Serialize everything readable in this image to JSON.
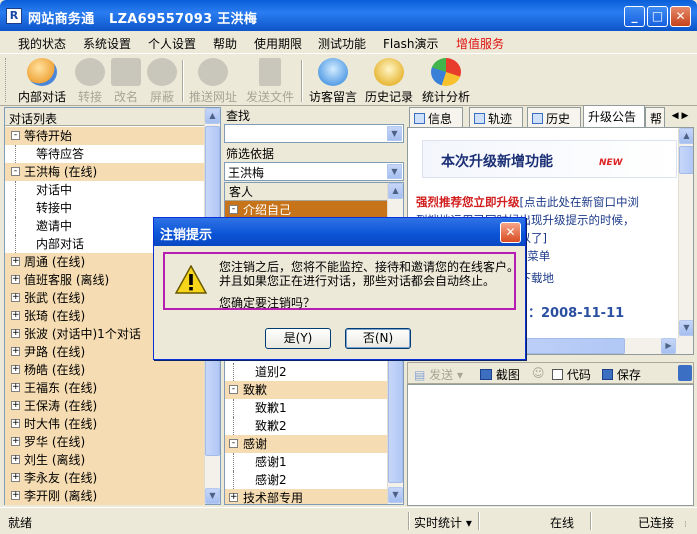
{
  "window": {
    "app_name": "网站商务通",
    "account": "LZA69557093 王洪梅",
    "min": "_",
    "max": "□",
    "close": "✕"
  },
  "menu": [
    "我的状态",
    "系统设置",
    "个人设置",
    "帮助",
    "使用期限",
    "测试功能",
    "Flash演示",
    "增值服务"
  ],
  "menu_highlight_color": "#e01010",
  "toolbar": [
    {
      "label": "内部对话",
      "icon": "people-icon",
      "enabled": true
    },
    {
      "label": "转接",
      "icon": "transfer-icon",
      "enabled": false
    },
    {
      "label": "改名",
      "icon": "rename-icon",
      "enabled": false
    },
    {
      "label": "屏蔽",
      "icon": "block-icon",
      "enabled": false
    },
    {
      "label": "推送网址",
      "icon": "globe-icon",
      "enabled": false
    },
    {
      "label": "发送文件",
      "icon": "file-icon",
      "enabled": false
    },
    {
      "label": "访客留言",
      "icon": "message-icon",
      "enabled": true
    },
    {
      "label": "历史记录",
      "icon": "history-icon",
      "enabled": true
    },
    {
      "label": "统计分析",
      "icon": "pie-chart-icon",
      "enabled": true
    }
  ],
  "left_panel": {
    "header": "对话列表",
    "rows": [
      {
        "text": "等待开始",
        "expander": "-",
        "indent": 0
      },
      {
        "text": "等待应答",
        "expander": "",
        "indent": 1
      },
      {
        "text": "王洪梅  (在线)",
        "expander": "-",
        "indent": 0
      },
      {
        "text": "对话中",
        "expander": "",
        "indent": 1
      },
      {
        "text": "转接中",
        "expander": "",
        "indent": 1
      },
      {
        "text": "邀请中",
        "expander": "",
        "indent": 1
      },
      {
        "text": "内部对话",
        "expander": "",
        "indent": 1
      },
      {
        "text": "周通  (在线)",
        "expander": "+",
        "indent": 0
      },
      {
        "text": "值班客服  (离线)",
        "expander": "+",
        "indent": 0
      },
      {
        "text": "张武  (在线)",
        "expander": "+",
        "indent": 0
      },
      {
        "text": "张琦  (在线)",
        "expander": "+",
        "indent": 0
      },
      {
        "text": "张波  (对话中)1个对话",
        "expander": "+",
        "indent": 0
      },
      {
        "text": "尹路  (在线)",
        "expander": "+",
        "indent": 0
      },
      {
        "text": "杨皓  (在线)",
        "expander": "+",
        "indent": 0
      },
      {
        "text": "王福东  (在线)",
        "expander": "+",
        "indent": 0
      },
      {
        "text": "王保涛  (在线)",
        "expander": "+",
        "indent": 0
      },
      {
        "text": "时大伟  (在线)",
        "expander": "+",
        "indent": 0
      },
      {
        "text": "罗华  (在线)",
        "expander": "+",
        "indent": 0
      },
      {
        "text": "刘生  (离线)",
        "expander": "+",
        "indent": 0
      },
      {
        "text": "李永友  (在线)",
        "expander": "+",
        "indent": 0
      },
      {
        "text": "李开刚  (离线)",
        "expander": "+",
        "indent": 0
      }
    ]
  },
  "mid_panel": {
    "search_label": "查找",
    "search_value": "",
    "filter_label": "筛选依据",
    "filter_value": "王洪梅",
    "list_header": "客人",
    "top_rows": [
      {
        "text": "介绍自己",
        "type": "group-selected",
        "expander": "-"
      }
    ],
    "bottom_rows": [
      {
        "text": "道别2",
        "type": "leaf"
      },
      {
        "text": "致歉",
        "type": "group",
        "expander": "-"
      },
      {
        "text": "致歉1",
        "type": "leaf"
      },
      {
        "text": "致歉2",
        "type": "leaf"
      },
      {
        "text": "感谢",
        "type": "group",
        "expander": "-"
      },
      {
        "text": "感谢1",
        "type": "leaf"
      },
      {
        "text": "感谢2",
        "type": "leaf"
      },
      {
        "text": "技术部专用",
        "type": "group",
        "expander": "+"
      }
    ]
  },
  "right_panel": {
    "tabs": [
      "信息",
      "轨迹",
      "历史",
      "升级公告",
      "帮"
    ],
    "active_tab": "升级公告",
    "notice_title": "本次升级新增功能",
    "new_badge": "NEW",
    "line1_bold": "强烈推荐您立即升级",
    "line1_rest": "[点击此处在新窗口中浏",
    "line2": "  到端地运用已同时候出现升级提示的时候，",
    "line3": "                 的文件进行安装就可以了]",
    "line4": "                注：点击 “使用期限” 菜单",
    "line5": "                下载安装进行升级，下载地",
    "date_text": "：2008-11-11"
  },
  "reply_toolbar": {
    "send": "发送",
    "screenshot": "截图",
    "code": "代码",
    "save": "保存"
  },
  "status": {
    "ready": "就绪",
    "stats": "实时统计",
    "online": "在线",
    "connected": "已连接"
  },
  "dialog": {
    "title": "注销提示",
    "close": "✕",
    "line1": "您注销之后，您将不能监控、接待和邀请您的在线客户。",
    "line2": "并且如果您正在进行对话，那些对话都会自动终止。",
    "line3": "您确定要注销吗？",
    "yes": "是(Y)",
    "no": "否(N)"
  }
}
